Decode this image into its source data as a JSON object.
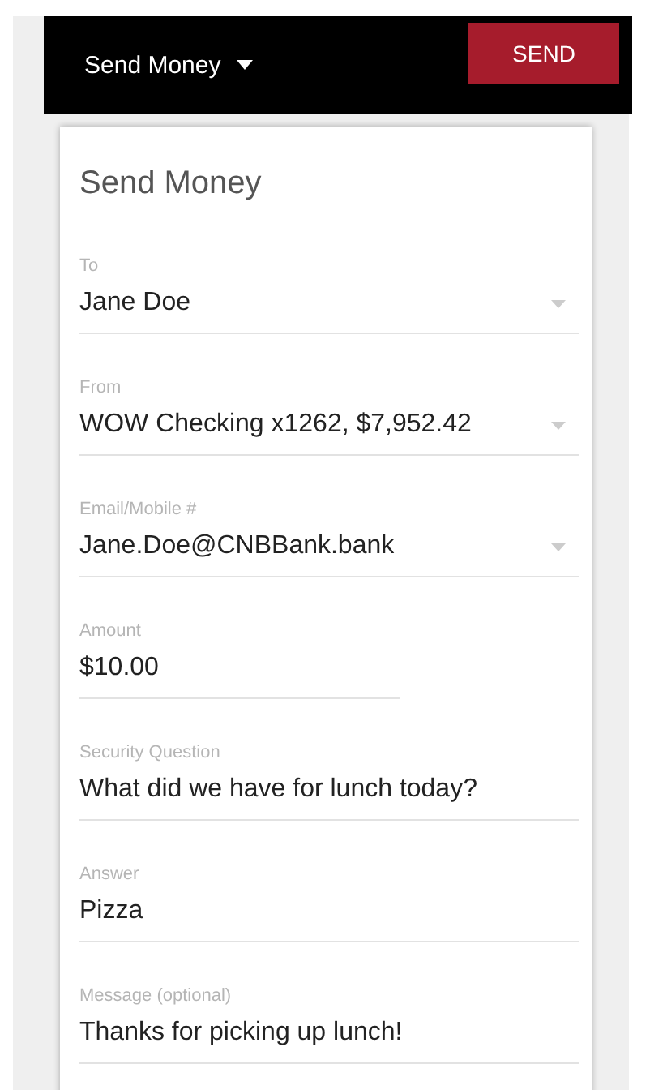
{
  "header": {
    "title": "Send Money",
    "send_button": "SEND"
  },
  "card": {
    "title": "Send Money",
    "fields": [
      {
        "kind": "select",
        "label": "To",
        "value": "Jane Doe"
      },
      {
        "kind": "select",
        "label": "From",
        "value": "WOW Checking x1262, $7,952.42"
      },
      {
        "kind": "select",
        "label": "Email/Mobile #",
        "value": "Jane.Doe@CNBBank.bank"
      },
      {
        "kind": "short",
        "label": "Amount",
        "value": "$10.00"
      },
      {
        "kind": "text",
        "label": "Security Question",
        "value": "What did we have for lunch today?"
      },
      {
        "kind": "text",
        "label": "Answer",
        "value": "Pizza"
      },
      {
        "kind": "text",
        "label": "Message (optional)",
        "value": "Thanks for picking up lunch!"
      }
    ]
  }
}
